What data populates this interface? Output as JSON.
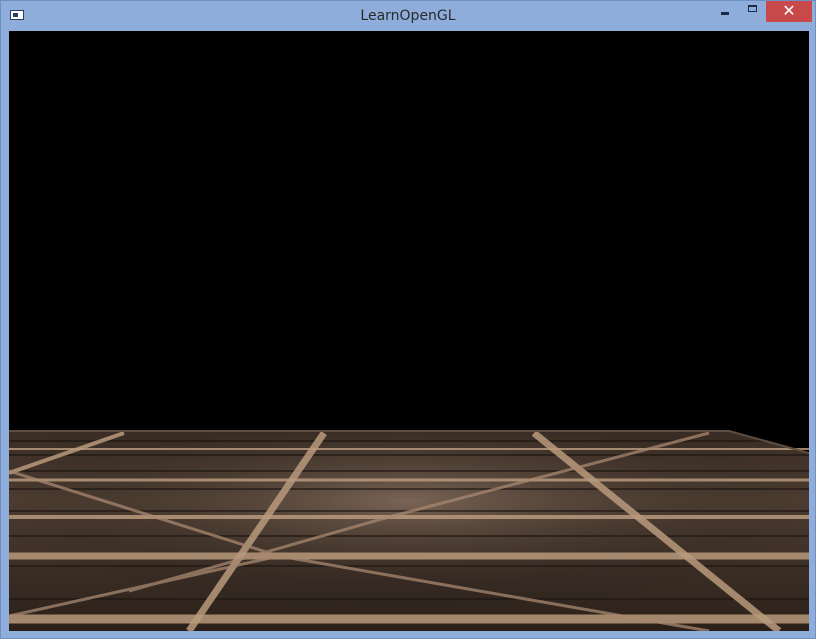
{
  "window": {
    "title": "LearnOpenGL",
    "controls": {
      "minimize_icon": "minimize-icon",
      "maximize_icon": "maximize-icon",
      "close_glyph": "✕"
    }
  },
  "scene": {
    "background_color": "#000000",
    "floor_color_dark": "#2e231d",
    "floor_color_light": "#8b725c",
    "plank_beam_color": "#b99a7c"
  },
  "colors": {
    "titlebar": "#8eaddb",
    "close_button": "#c7494a"
  }
}
